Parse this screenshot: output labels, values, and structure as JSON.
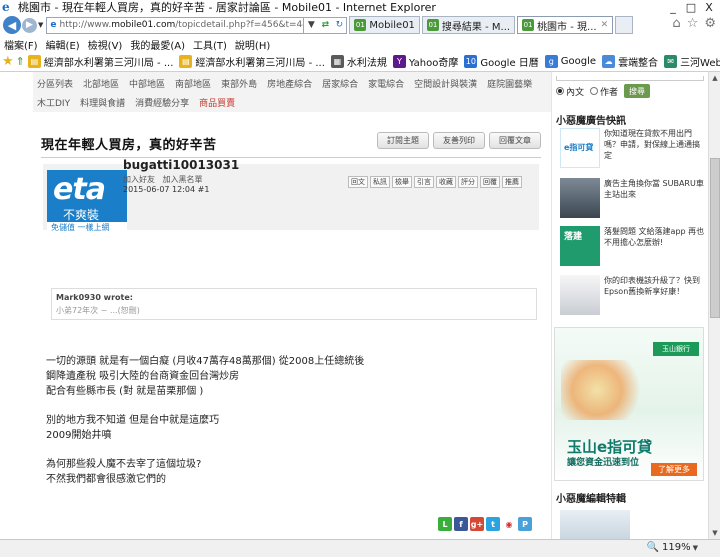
{
  "window": {
    "title": "桃園市 - 現在年輕人買房，真的好辛苦 - 居家討論區 - Mobile01 - Internet Explorer",
    "controls": [
      "_",
      "□",
      "X"
    ]
  },
  "address": {
    "url_prefix": "http://www.",
    "url_host": "mobile01.com",
    "url_path": "/topicdetail.php?f=456&t=4410670"
  },
  "tabs": [
    {
      "label": "Mobile01",
      "icon": "01"
    },
    {
      "label": "搜尋結果 - M...",
      "icon": "01"
    },
    {
      "label": "桃園市 - 現...",
      "icon": "01"
    }
  ],
  "menu": [
    "檔案(F)",
    "編輯(E)",
    "檢視(V)",
    "我的最愛(A)",
    "工具(T)",
    "說明(H)"
  ],
  "favorites": [
    {
      "label": "經濟部水利署第三河川局 - ...",
      "icon": "file-icon",
      "color": "#e8b21d"
    },
    {
      "label": "經濟部水利署第三河川局 - ...",
      "icon": "file-icon",
      "color": "#e8b21d"
    },
    {
      "label": "水利法規",
      "icon": "law-icon",
      "color": "#5a5a5a"
    },
    {
      "label": "Yahoo奇摩",
      "icon": "Y",
      "color": "#5c1a8a"
    },
    {
      "label": "Google 日曆",
      "icon": "10",
      "color": "#2a6fd1"
    },
    {
      "label": "Google",
      "icon": "g",
      "color": "#3a7bd5"
    },
    {
      "label": "雲端整合",
      "icon": "cloud-icon",
      "color": "#4a8ad9"
    },
    {
      "label": "三河WebMail",
      "icon": "mail-icon",
      "color": "#2a8a6a"
    }
  ],
  "catnav": {
    "row1": [
      "分區列表",
      "北部地區",
      "中部地區",
      "南部地區",
      "東部外島",
      "房地產綜合",
      "居家綜合",
      "家電綜合",
      "空間設計與裝潢",
      "庭院園藝樂"
    ],
    "row2": [
      "木工DIY",
      "料理與食譜",
      "消費經驗分享",
      "商品買賣"
    ]
  },
  "post": {
    "title": "現在年輕人買房，真的好辛苦",
    "header_buttons": [
      "訂閱主題",
      "友善列印",
      "回覆文章"
    ],
    "avatar": {
      "logo": "eta",
      "sub": "不爽裝",
      "strip": "免儲值 一樣上網"
    },
    "username": "bugatti10013031",
    "user_links": [
      "加入好友",
      "加入黑名單"
    ],
    "date": "2015-06-07 12:04  #1",
    "actions": [
      "回文",
      "私訊",
      "檢舉",
      "引言",
      "收藏",
      "評分",
      "回覆",
      "推薦"
    ],
    "quote_author": "Mark0930 wrote:",
    "quote_text": "小弟72年次 ~ ...(恕刪)",
    "body": [
      "一切的源頭 就是有一個白癡 (月收47萬存48萬那個) 從2008上任總統後",
      "鋼降遺產稅 吸引大陸的台商資金回台灣炒房",
      "配合有些縣市長 (對 就是苗栗那個 )",
      "",
      "別的地方我不知道 但是台中就是這麼巧",
      "2009開始井噴",
      "",
      "為何那些殺人魔不去宰了這個垃圾?",
      "不然我們都會很感激它們的"
    ],
    "share_icons": [
      "line-icon",
      "facebook-icon",
      "google-plus-icon",
      "twitter-icon",
      "weibo-icon",
      "plurk-icon"
    ]
  },
  "sidebar": {
    "search_options": [
      "內文",
      "作者"
    ],
    "search_selected": "內文",
    "search_button": "搜尋",
    "ad_heading": "小惡魔廣告快訊",
    "ads": [
      {
        "text": "你知道現在貸款不用出門嗎？申請，對保線上通通搞定",
        "thumb": "e指可貸"
      },
      {
        "text": "廣告主角換你當 SUBARU車主站出來",
        "thumb": "car"
      },
      {
        "text": "落髮問題 文給落建app 再也不用擔心怎麼辦!",
        "thumb": "落建"
      },
      {
        "text": "你的印表機該升級了？快到Epson舊換新享好康！",
        "thumb": "printer"
      }
    ],
    "banner": {
      "brand": "玉山銀行",
      "big": "玉山e指可貸",
      "sub": "讓您資金迅速到位",
      "cta": "了解更多"
    },
    "editor_heading": "小惡魔編輯特輯"
  },
  "status": {
    "zoom": "119%"
  },
  "colors": {
    "accent": "#1b7ec9",
    "green_btn": "#6b9a4e",
    "banner_green": "#0f7a6b",
    "cta": "#e96a1f"
  }
}
